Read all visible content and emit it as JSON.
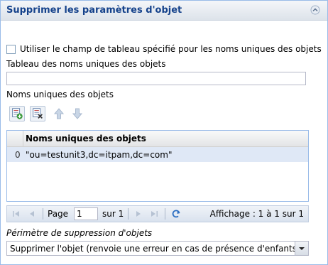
{
  "panel": {
    "title": "Supprimer les paramètres d'objet",
    "collapse_icon": "chevron-up-icon"
  },
  "form": {
    "use_array_checkbox": {
      "label": "Utiliser le champ de tableau spécifié pour les noms uniques des objets",
      "checked": false
    },
    "array_field_label": "Tableau des noms uniques des objets",
    "array_field_value": "",
    "dn_label": "Noms uniques des objets"
  },
  "toolbar": {
    "buttons": [
      {
        "icon": "add-row-icon"
      },
      {
        "icon": "delete-row-icon"
      },
      {
        "icon": "arrow-up-icon"
      },
      {
        "icon": "arrow-down-icon"
      }
    ]
  },
  "grid": {
    "column": "Noms uniques des objets",
    "rows": [
      {
        "index": "0",
        "value": "\"ou=testunit3,dc=itpam,dc=com\""
      }
    ]
  },
  "pager": {
    "page_label": "Page",
    "page_value": "1",
    "of_label": "sur 1",
    "display_info": "Affichage : 1 à 1 sur 1",
    "icons": [
      "first-page-icon",
      "prev-page-icon",
      "next-page-icon",
      "last-page-icon",
      "refresh-icon"
    ]
  },
  "scope": {
    "label": "Périmètre de suppression d'objets",
    "selected": "Supprimer l'objet (renvoie une erreur en cas de présence d'enfants)"
  },
  "colors": {
    "header_text": "#15428b",
    "border": "#99bbe8",
    "selected_row": "#dfe8f6"
  }
}
